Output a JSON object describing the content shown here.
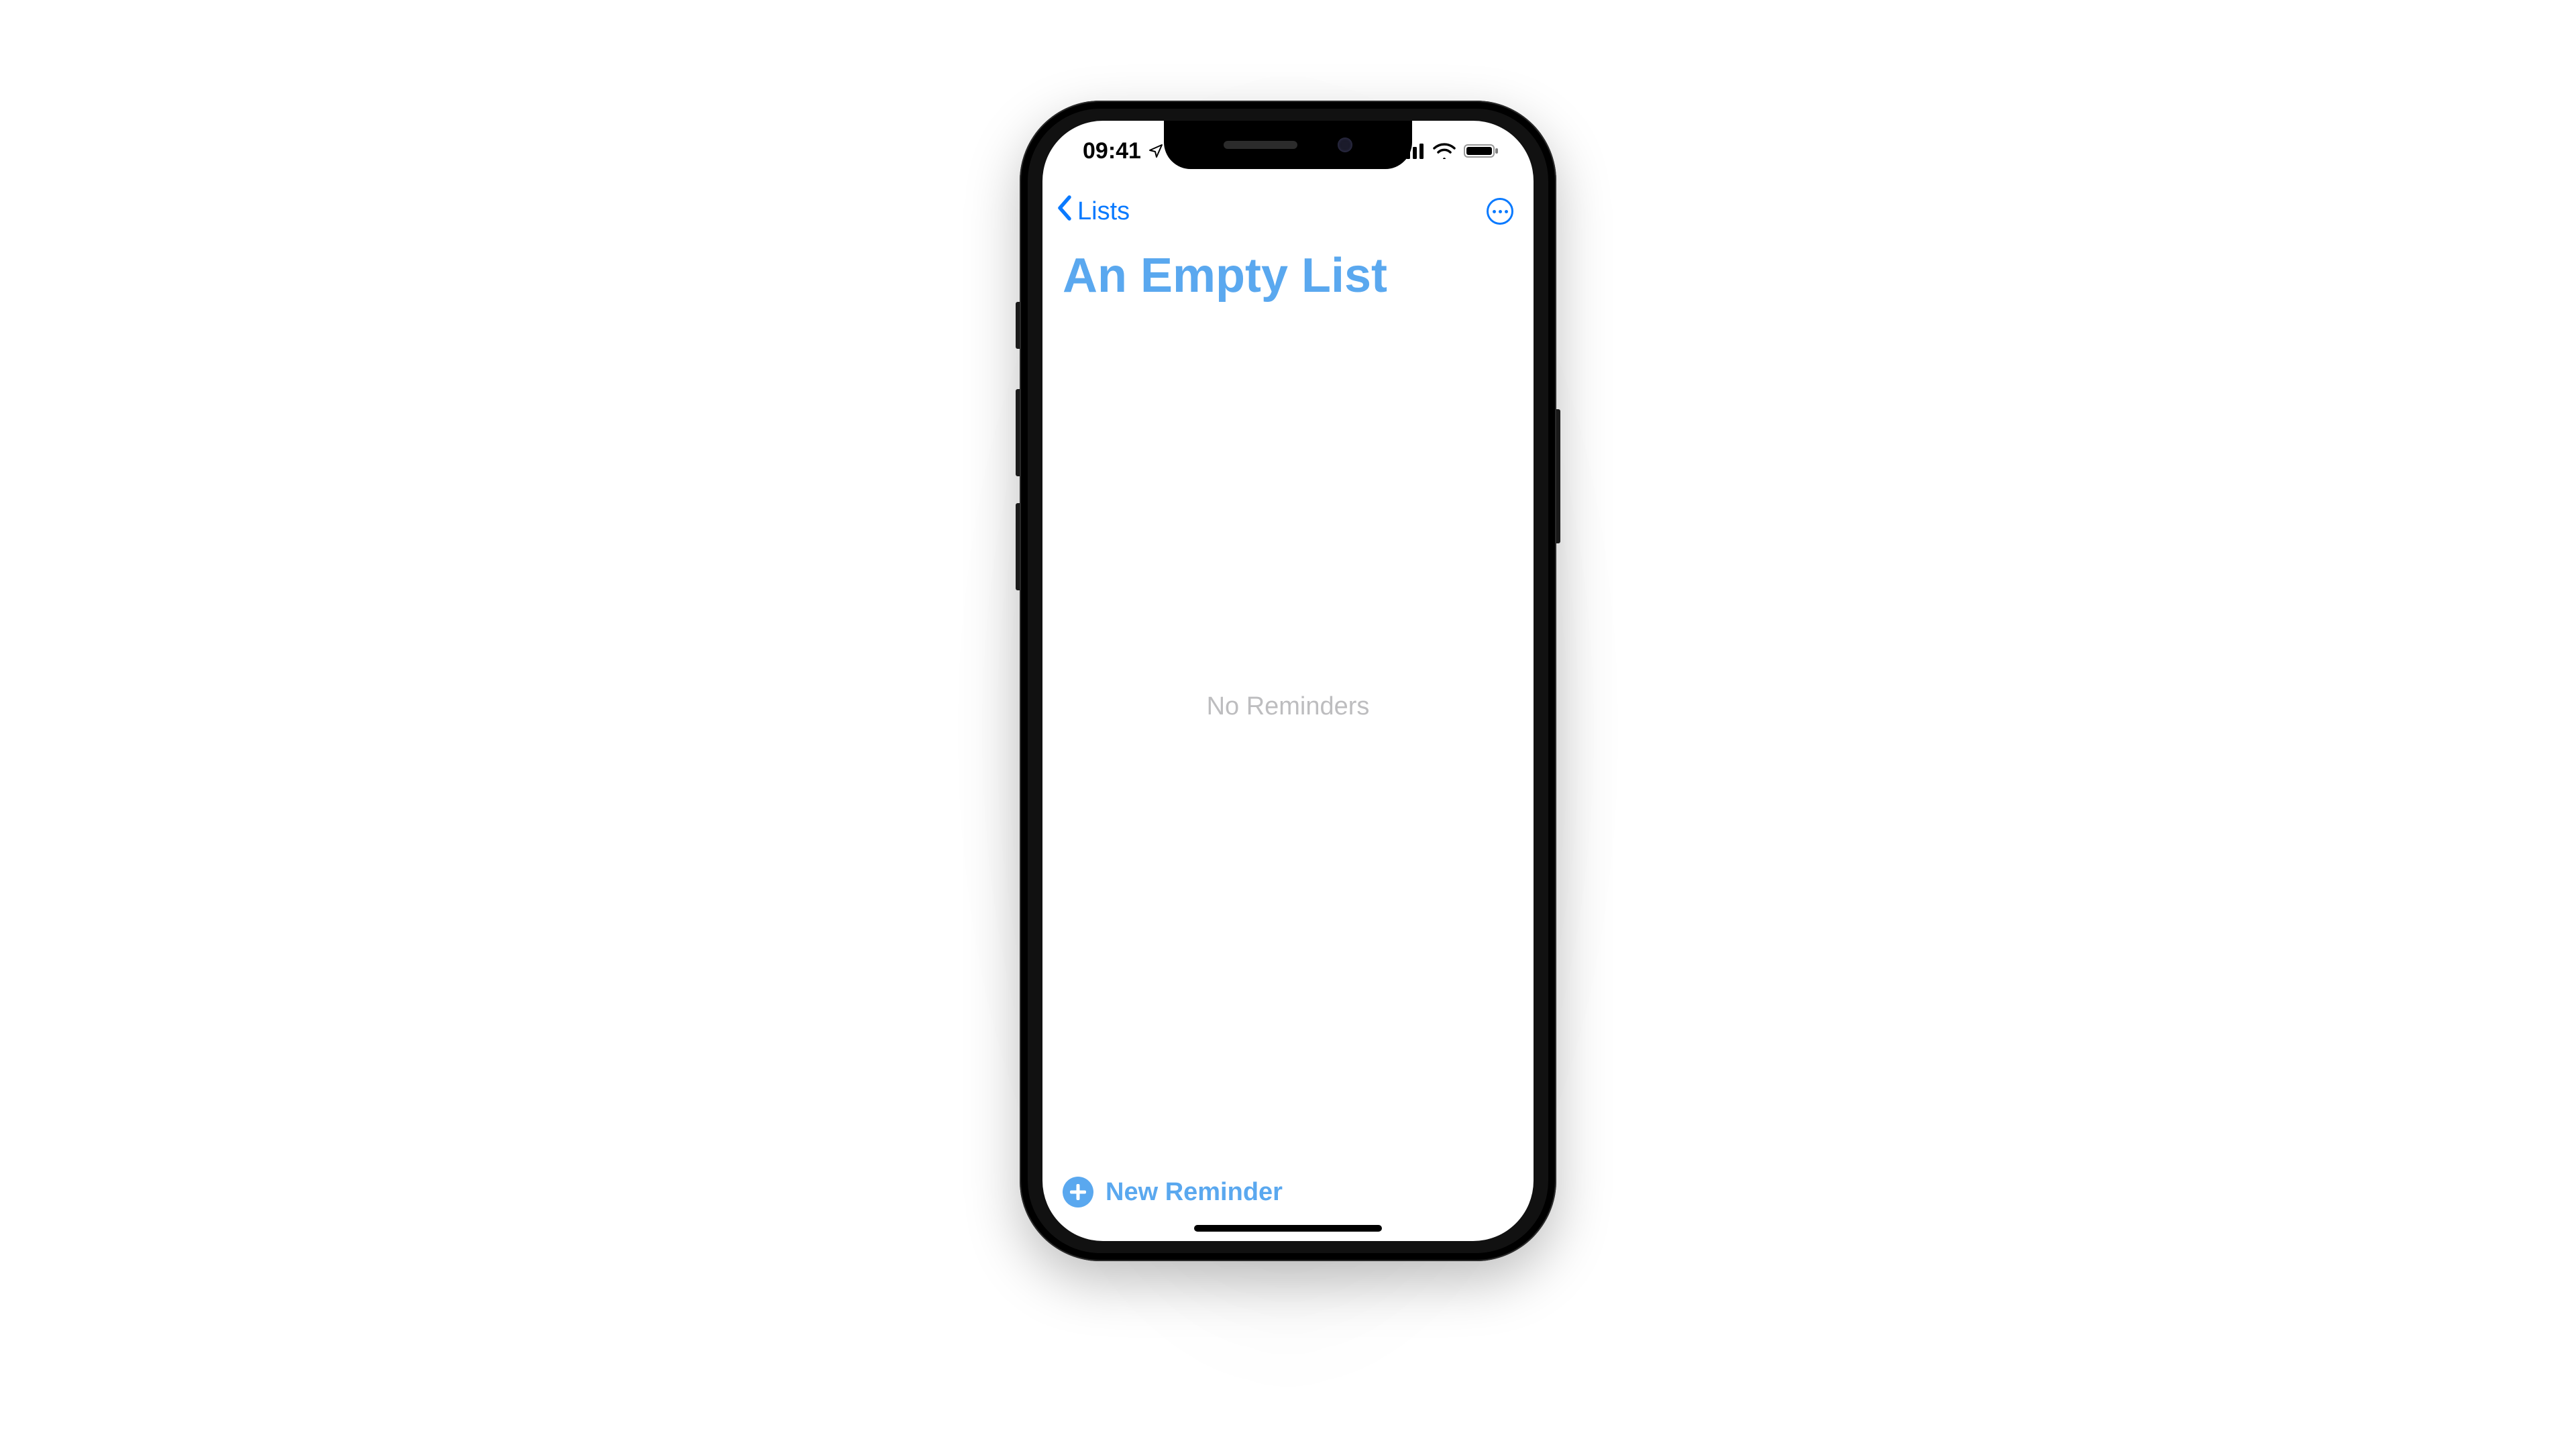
{
  "statusbar": {
    "time": "09:41"
  },
  "navbar": {
    "back_label": "Lists"
  },
  "page": {
    "title": "An Empty List",
    "empty_message": "No Reminders"
  },
  "bottom": {
    "new_reminder_label": "New Reminder"
  },
  "colors": {
    "accent": "#0a7aff",
    "title": "#5aa8ef"
  }
}
